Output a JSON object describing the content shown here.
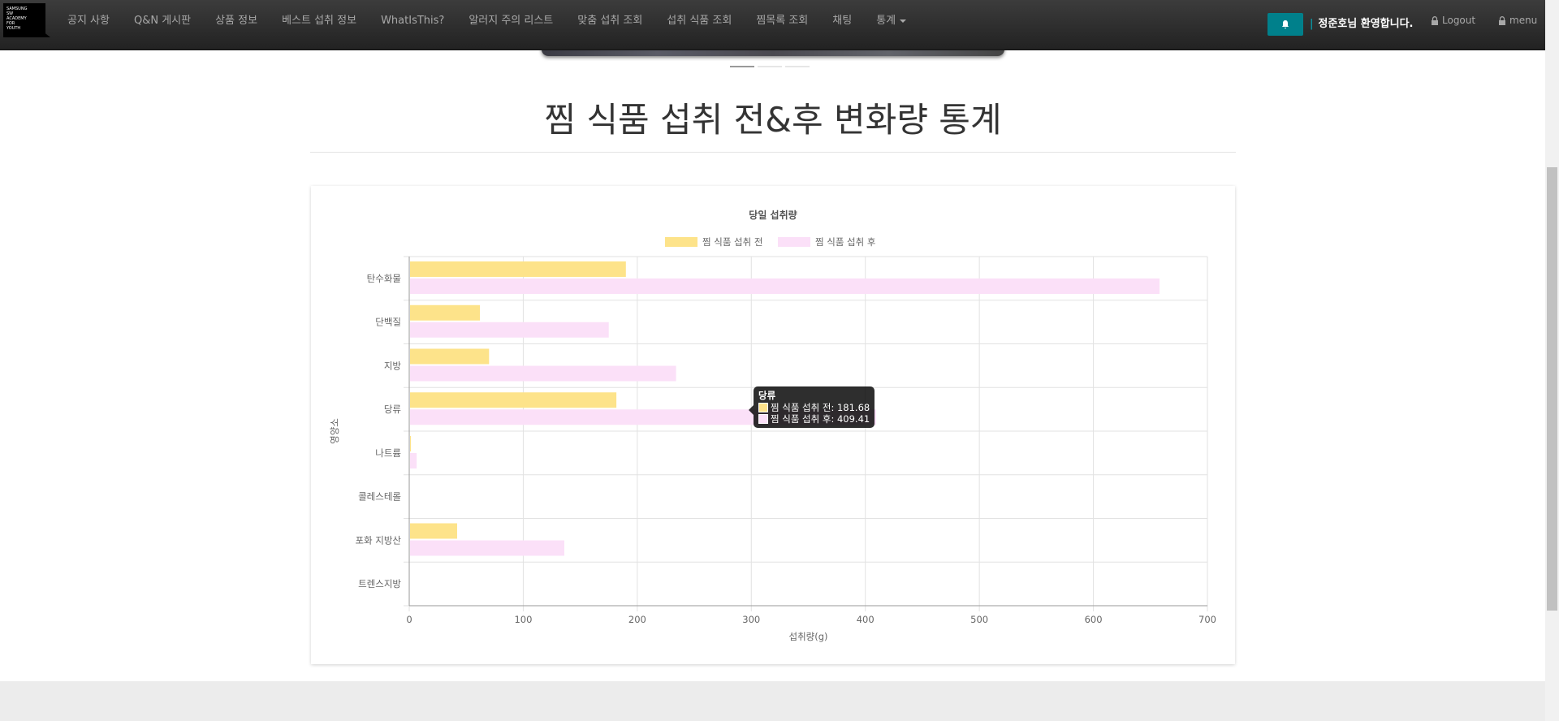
{
  "nav": {
    "logo_text": "SAMSUNG SW ACADEMY FOR YOUTH",
    "items": [
      "공지 사항",
      "Q&N 게시판",
      "상품 정보",
      "베스트 섭취 정보",
      "WhatIsThis?",
      "알러지 주의 리스트",
      "맞춤 섭취 조회",
      "섭취 식품 조회",
      "찜목록 조회",
      "채팅",
      "통계"
    ],
    "welcome": "정준호님 환영합니다.",
    "logout": "Logout",
    "menu": "menu"
  },
  "page": {
    "title": "찜 식품 섭취 전&후 변화량 통계"
  },
  "chart_data": {
    "type": "bar",
    "orientation": "horizontal",
    "title": "당일 섭취량",
    "xlabel": "섭취량(g)",
    "ylabel": "영양소",
    "categories": [
      "탄수화물",
      "단백질",
      "지방",
      "당류",
      "나트륨",
      "콜레스테롤",
      "포화 지방산",
      "트렌스지방"
    ],
    "series": [
      {
        "name": "찜 식품 섭취 전",
        "color": "#fde38a",
        "values": [
          190,
          62,
          70,
          181.68,
          1.5,
          0,
          42,
          0
        ]
      },
      {
        "name": "찜 식품 섭취 후",
        "color": "#fbe0f8",
        "values": [
          658,
          175,
          234,
          409.41,
          6.5,
          0,
          136,
          0
        ]
      }
    ],
    "xlim": [
      0,
      700
    ],
    "xticks": [
      0,
      100,
      200,
      300,
      400,
      500,
      600,
      700
    ],
    "grid": true,
    "legend_position": "top"
  },
  "tooltip": {
    "title": "당류",
    "rows": [
      "찜 식품 섭취 전: 181.68",
      "찜 식품 섭취 후: 409.41"
    ]
  }
}
